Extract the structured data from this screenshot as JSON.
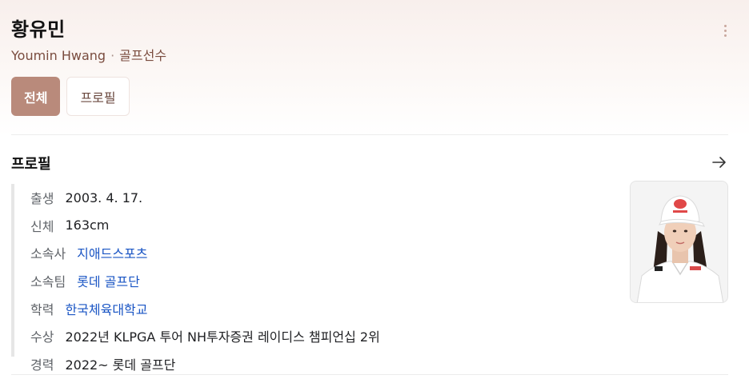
{
  "header": {
    "title": "황유민",
    "subtitle_name": "Youmin Hwang",
    "subtitle_sep": "·",
    "subtitle_role": "골프선수"
  },
  "tabs": [
    {
      "label": "전체",
      "active": true
    },
    {
      "label": "프로필",
      "active": false
    }
  ],
  "profile": {
    "section_title": "프로필",
    "rows": [
      {
        "label": "출생",
        "value": "2003. 4. 17.",
        "link": false
      },
      {
        "label": "신체",
        "value": "163cm",
        "link": false
      },
      {
        "label": "소속사",
        "value": "지애드스포츠",
        "link": true
      },
      {
        "label": "소속팀",
        "value": "롯데 골프단",
        "link": true
      },
      {
        "label": "학력",
        "value": "한국체육대학교",
        "link": true
      },
      {
        "label": "수상",
        "value": "2022년 KLPGA 투어 NH투자증권 레이디스 챔피언십 2위",
        "link": false
      },
      {
        "label": "경력",
        "value": "2022~ 롯데 골프단",
        "link": false
      }
    ]
  },
  "icons": {
    "more": "more-vertical-icon",
    "arrow": "arrow-right-icon"
  },
  "colors": {
    "accent": "#b98a7b",
    "link": "#1a55c4",
    "subtitle": "#7a4c3f"
  }
}
